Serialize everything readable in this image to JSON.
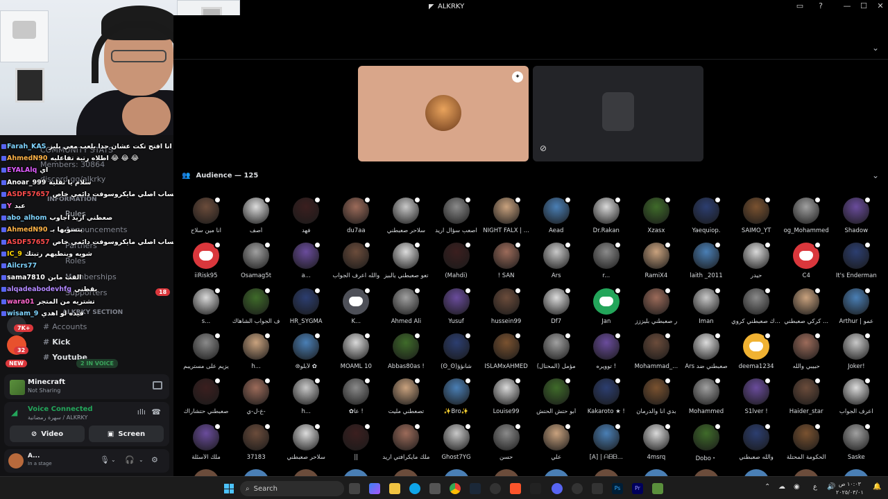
{
  "window": {
    "title": "ALKRKY",
    "ctrl_min": "—",
    "ctrl_max": "☐",
    "ctrl_close": "✕",
    "help": "?",
    "inbox": "▭"
  },
  "chat": [
    {
      "user": "Farah_KAS",
      "color": "#7fd4ff",
      "msg": "انا افتح تكت عشان حدا يلعب معي بليز 😭"
    },
    {
      "user": "AhmedN90",
      "color": "#ffb347",
      "msg": "اطلاه رتبة تفاعليه 😂 😂 😂"
    },
    {
      "user": "EYALAlq",
      "color": "#e05cff",
      "msg": "اي"
    },
    {
      "user": "Anoar_999",
      "color": "#ffffff",
      "msg": "سلام يا ثقلية"
    },
    {
      "user": "ASDF57657",
      "color": "#ff4c4c",
      "msg": "زين ماكو اريد حساب اصلي مايكروسوفت دائمي خاص"
    },
    {
      "user": "Y",
      "color": "#ff66cc",
      "msg": "عيد"
    },
    {
      "user": "abo_alhom",
      "color": "#7fd4ff",
      "msg": "صعطني اريد اجاوب"
    },
    {
      "user": "AhmedN90",
      "color": "#ffb347",
      "msg": "بتسويها بـ"
    },
    {
      "user": "ASDF57657",
      "color": "#ff4c4c",
      "msg": "زين ماكو اريد حساب اصلي مايكروسوفت دائمي خاص"
    },
    {
      "user": "IC_9",
      "color": "#ffd700",
      "msg": "شويه وينطيهم رتبتك"
    },
    {
      "user": "Ailcrs77",
      "color": "#7fd4ff",
      "msg": ""
    },
    {
      "user": "sama7810",
      "color": "#ffffff",
      "msg": "القب مابن"
    },
    {
      "user": "alqadeabodevhfg",
      "color": "#b388ff",
      "msg": "يقطني"
    },
    {
      "user": "wara01",
      "color": "#ff66cc",
      "msg": "تشتريه من المتجر"
    },
    {
      "user": "wisam_9",
      "color": "#7fd4ff",
      "msg": "قيده لو اهدي"
    }
  ],
  "channels": {
    "header_stats": "COMMUNITY STATS",
    "members": "Members: 30864",
    "invite": "discord.gg/alkrky",
    "info_header": "INFORMATION",
    "rules": "Rules",
    "announcements": "Announcements",
    "partners": "Partners",
    "roles": "Roles",
    "memberships": "Memberships",
    "supporters": "Supporters",
    "supporters_count": "18",
    "section": "ALKRKY SECTION",
    "accounts": "Accounts",
    "kick": "Kick",
    "youtube": "Youtube",
    "voice_count": "2 IN VOICE",
    "new_pill": "NEW",
    "server_badge": "32",
    "k_badge": "7K+"
  },
  "activity": {
    "title": "Minecraft",
    "sub": "Not Sharing"
  },
  "voice": {
    "title": "Voice Connected",
    "sub": "سهرة رمضانية / ALKRKY",
    "video": "Video",
    "screen": "Screen"
  },
  "user": {
    "name": "A...",
    "status": "In a stage"
  },
  "stage": {
    "audience_label": "Audience — 125"
  },
  "audience": [
    [
      "انا مين سلاح",
      "أصف",
      "فهد",
      "du7aa",
      "سلاحر صعبطني",
      "اصعب سؤال اريد",
      "NIGHT FALX | ...",
      "Aead",
      "Dr.Rakan",
      "Xzasx",
      "Yaequiop.",
      "SAIMO_YT",
      "og_Mohammed",
      "Shadow"
    ],
    [
      "iiRisk95",
      "Osamag5t",
      "a...",
      "والله اعرف الجواب",
      "تعو صعبطني يالبيز",
      "(Mahdi)",
      "! SAN",
      "Ars",
      "r...",
      "RamiX4",
      "laith _2011",
      "حيدر",
      "C4",
      "It's Enderman"
    ],
    [
      "s...",
      "ف الجواب الشاهاك",
      "HR_SYGMA",
      "K...",
      "Ahmed Ali",
      "Yusuf",
      "hussein99",
      "Df7",
      "Jan",
      "ر صعبطني بليززز",
      "Iman",
      "اتحداك صعبطني كروي",
      "كركي صعبطني ...",
      "Arthur | عمو"
    ],
    [
      "يزيم على مستريبم",
      "h...",
      "⊛لأبلو ✿",
      "MOAML 10",
      "Abbas80as !",
      "(ʘ_ʘ)شانؤؤ",
      "ISLAMxAHMED",
      "مؤمل (المحتال)",
      "توويره !",
      "Mohammad_...",
      "Ars صعبطني ضد",
      "deema1234",
      "حبيبي والله",
      "Joker!"
    ],
    [
      "صعبطني حتشاراك",
      "ع-ل-ي-",
      "h...",
      "✿عا !",
      "تصعطني مليت",
      "✨Bro✨",
      "Louise99",
      "أبو حتش الحتش",
      "Kakaroto ★ !",
      "بدي انا والدرمان",
      "Mohammed",
      "S1lver !",
      "Haider_star",
      "اعرف الجواب"
    ],
    [
      "ملك الأسئلة",
      "37183",
      "سلاحر صعبطني",
      "||",
      "ملك مايكرافتي اريد",
      "Ghost7YG",
      "حسن",
      "علي",
      "[A] | ᗩᗷᗷ...",
      "4msrq",
      "Dobo・",
      "والله صعبطني",
      "الحكومة المحتلة",
      "Saske"
    ]
  ],
  "taskbar": {
    "search": "Search",
    "time": "١٠:٠٣ ص",
    "date": "٢٠٢٥/٠٣/٠١",
    "lang": "ع"
  }
}
